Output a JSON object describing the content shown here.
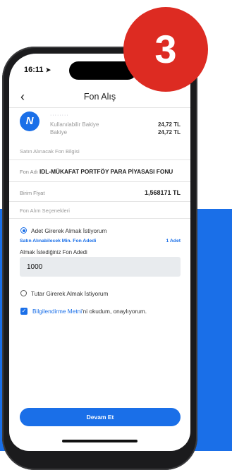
{
  "badge": {
    "number": "3"
  },
  "status": {
    "time": "16:11",
    "arrow": "➤"
  },
  "nav": {
    "back": "‹",
    "title": "Fon Alış"
  },
  "account": {
    "logo_letter": "N",
    "masked_number": "········",
    "available_label": "Kullanılabilir Bakiye",
    "available_value": "24,72 TL",
    "balance_label": "Bakiye",
    "balance_value": "24,72 TL"
  },
  "fund_info": {
    "section_title": "Satın Alınacak Fon Bilgisi",
    "name_label": "Fon Adı",
    "name_value": "IDL-MÜKAFAT PORTFÖY PARA PİYASASI FONU",
    "price_label": "Birim Fiyat",
    "price_value": "1,568171 TL"
  },
  "options": {
    "section_title": "Fon Alım Seçenekleri",
    "by_units_label": "Adet Girerek Almak İstiyorum",
    "min_label": "Satın Alınabilecek Min. Fon Adedi",
    "min_value": "1 Adet",
    "qty_label": "Almak İstediğiniz Fon Adedi",
    "qty_value": "1000",
    "by_amount_label": "Tutar Girerek Almak İstiyorum"
  },
  "consent": {
    "check": "✓",
    "link_text": "Bilgilendirme Metni",
    "rest_text": "'ni okudum, onaylıyorum."
  },
  "footer": {
    "continue_label": "Devam Et"
  }
}
